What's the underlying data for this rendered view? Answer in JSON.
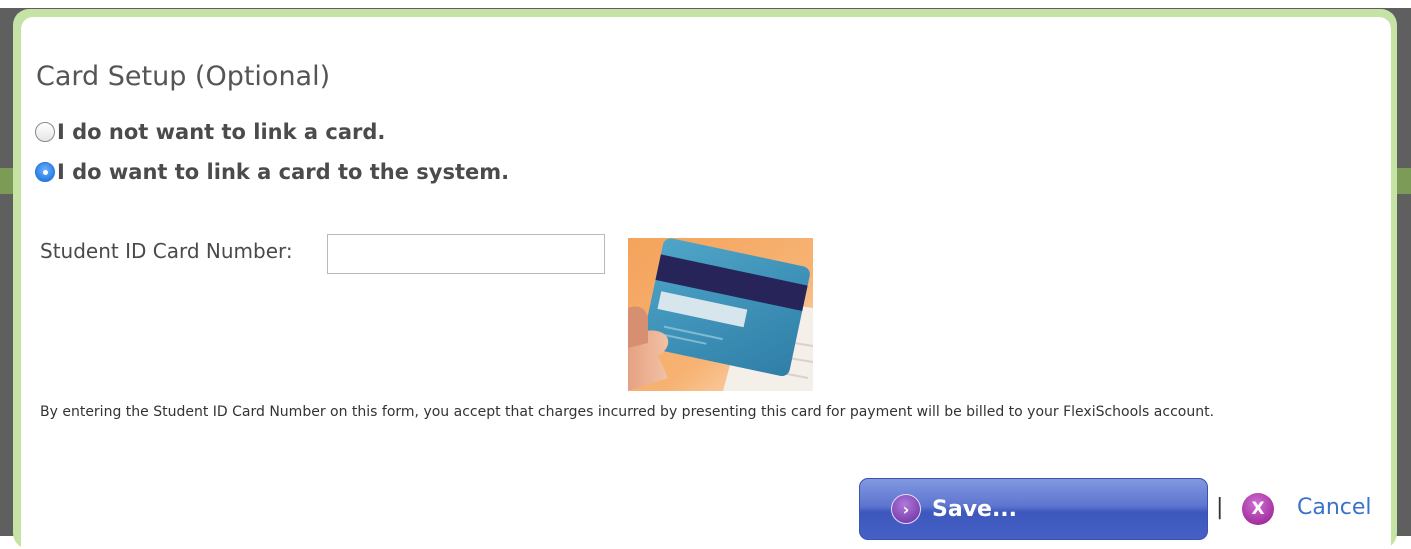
{
  "dialog": {
    "title": "Card Setup (Optional)",
    "options": [
      {
        "label": "I do not want to link a card.",
        "checked": false
      },
      {
        "label": "I do want to link a card to the system.",
        "checked": true
      }
    ],
    "card_field": {
      "label": "Student ID Card Number:",
      "value": "",
      "placeholder": ""
    },
    "disclaimer": "By entering the Student ID Card Number on this form, you accept that charges incurred by presenting this card for payment will be billed to your FlexiSchools account.",
    "save_label": "Save...",
    "separator": "|",
    "cancel_label": "Cancel",
    "save_icon_glyph": "›",
    "cancel_icon_glyph": "X"
  },
  "colors": {
    "dialog_border": "#c4e3a4",
    "save_button": "#4a63c6",
    "cancel_icon": "#a5319f",
    "link": "#3a73c9"
  },
  "icons": [
    "radio-unchecked-icon",
    "radio-checked-icon",
    "arrow-right-icon",
    "close-x-icon"
  ]
}
